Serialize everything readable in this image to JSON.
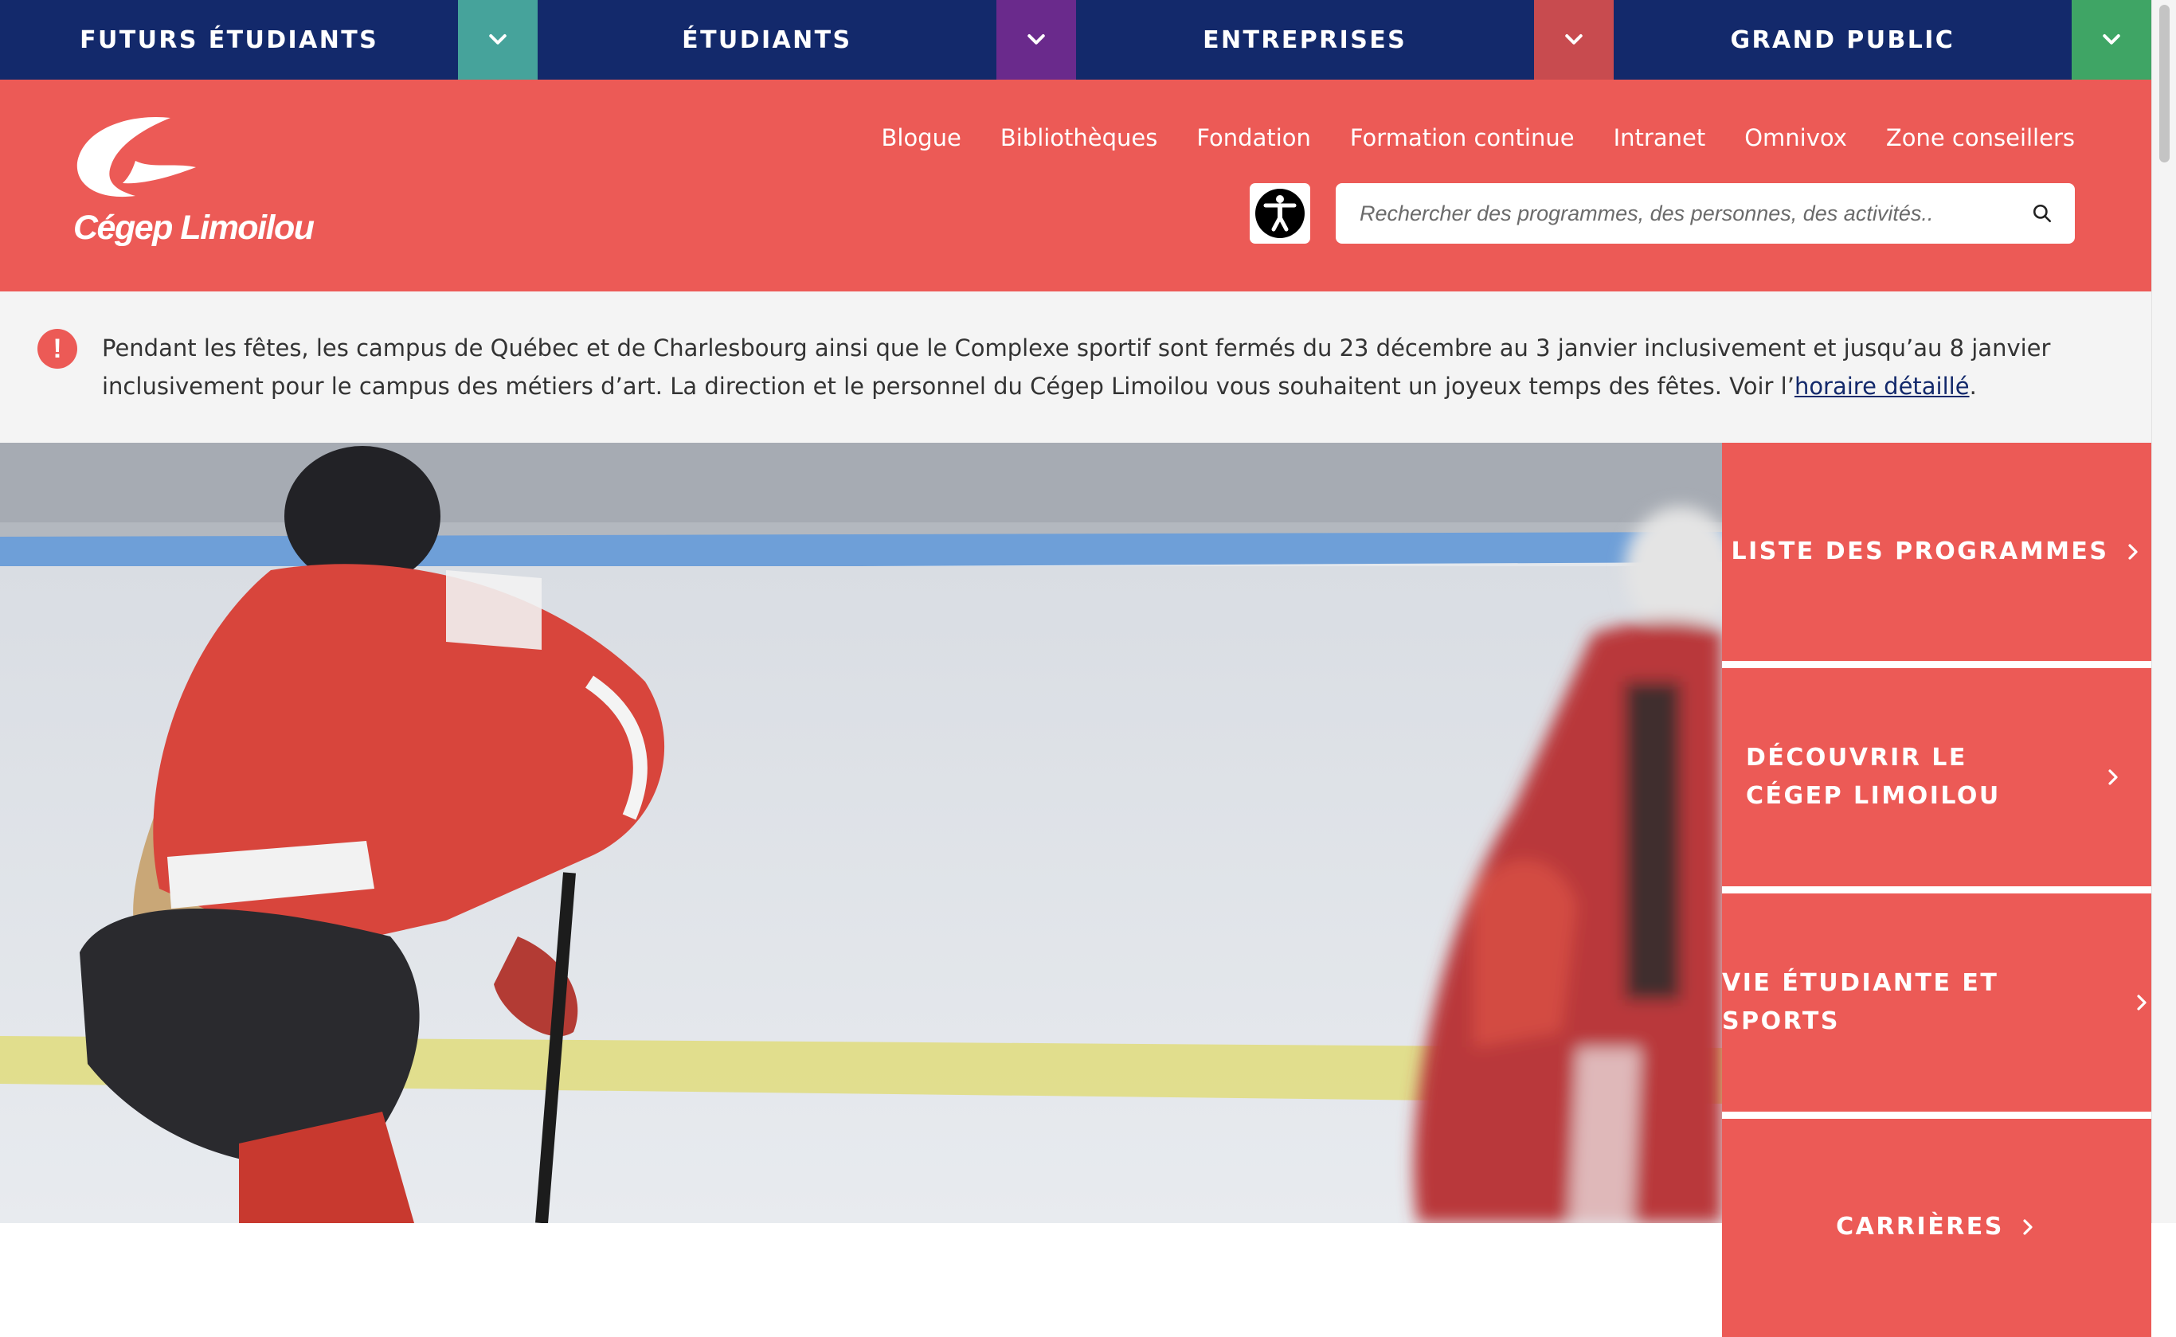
{
  "audience_nav": {
    "items": [
      {
        "label": "FUTURS ÉTUDIANTS",
        "accent": "#46a39b"
      },
      {
        "label": "ÉTUDIANTS",
        "accent": "#6a2a8c"
      },
      {
        "label": "ENTREPRISES",
        "accent": "#c84b4f"
      },
      {
        "label": "GRAND PUBLIC",
        "accent": "#3fa565"
      }
    ]
  },
  "header": {
    "logo_text": "Cégep Limoilou",
    "utility_links": [
      "Blogue",
      "Bibliothèques",
      "Fondation",
      "Formation continue",
      "Intranet",
      "Omnivox",
      "Zone conseillers"
    ],
    "search_placeholder": "Rechercher des programmes, des personnes, des activités..",
    "accessibility_icon": "accessibility-icon",
    "search_icon": "search-icon"
  },
  "alert": {
    "text": "Pendant les fêtes, les campus de Québec et de Charlesbourg ainsi que le Complexe sportif sont fermés du 23 décembre au 3 janvier inclusivement et jusqu’au 8 janvier inclusivement pour le campus des métiers d’art. La direction et le personnel du Cégep Limoilou vous souhaitent un joyeux temps des fêtes. Voir l’",
    "link_text": "horaire détaillé",
    "end": "."
  },
  "quick_links": [
    "LISTE DES PROGRAMMES",
    "DÉCOUVRIR LE CÉGEP LIMOILOU",
    "VIE ÉTUDIANTE ET SPORTS",
    "CARRIÈRES"
  ],
  "colors": {
    "brand_red": "#ec5a56",
    "navy": "#13296b",
    "alert_bg": "#f4f4f4"
  }
}
